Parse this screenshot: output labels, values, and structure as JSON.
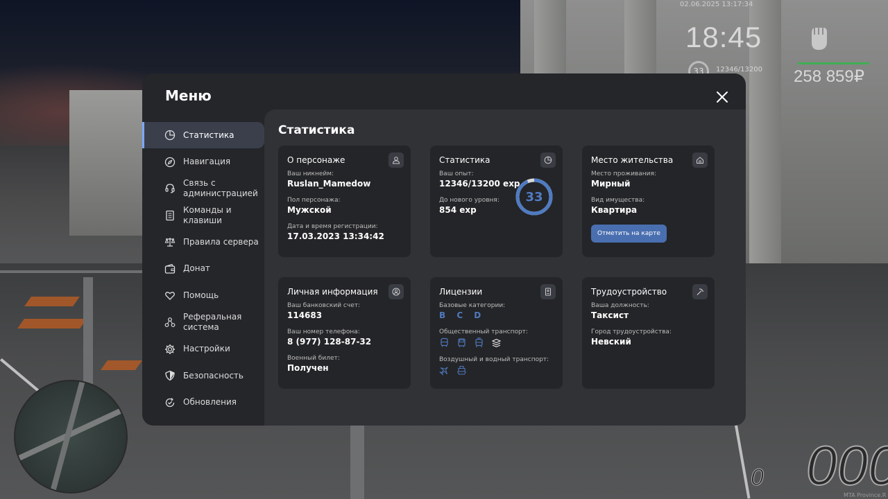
{
  "hud": {
    "datetime": "02.06.2025 13:17:34",
    "time": "18:45",
    "level": "33",
    "exp": "12346/13200",
    "money": "258 859₽",
    "speed": "000",
    "gear": "0",
    "server": "MTA Province.R"
  },
  "menu": {
    "title": "Меню",
    "nav": [
      {
        "label": "Статистика",
        "icon": "pie-chart-icon",
        "active": true
      },
      {
        "label": "Навигация",
        "icon": "compass-icon"
      },
      {
        "label": "Связь с администрацией",
        "icon": "headset-icon"
      },
      {
        "label": "Команды и клавиши",
        "icon": "document-icon"
      },
      {
        "label": "Правила сервера",
        "icon": "scales-icon"
      },
      {
        "label": "Донат",
        "icon": "wallet-icon"
      },
      {
        "label": "Помощь",
        "icon": "heart-hands-icon"
      },
      {
        "label": "Реферальная система",
        "icon": "network-icon"
      },
      {
        "label": "Настройки",
        "icon": "gear-icon"
      },
      {
        "label": "Безопасность",
        "icon": "shield-icon"
      },
      {
        "label": "Обновления",
        "icon": "refresh-check-icon"
      }
    ]
  },
  "content": {
    "title": "Статистика",
    "character": {
      "title": "О персонаже",
      "nick_label": "Ваш никнейм:",
      "nick": "Ruslan_Mamedow",
      "gender_label": "Пол персонажа:",
      "gender": "Мужской",
      "reg_label": "Дата и время регистрации:",
      "reg": "17.03.2023 13:34:42"
    },
    "stats": {
      "title": "Статистика",
      "exp_label": "Ваш опыт:",
      "exp": "12346/13200 exp",
      "next_label": "До нового уровня:",
      "next": "854 exp",
      "level": "33",
      "progress": 0.935
    },
    "residence": {
      "title": "Место жительства",
      "place_label": "Место проживания:",
      "place": "Мирный",
      "property_label": "Вид имущества:",
      "property": "Квартира",
      "map_button": "Отметить на карте"
    },
    "personal": {
      "title": "Личная информация",
      "bank_label": "Ваш банковский счет:",
      "bank": "114683",
      "phone_label": "Ваш номер телефона:",
      "phone": "8 (977) 128-87-32",
      "military_label": "Военный билет:",
      "military": "Получен"
    },
    "licenses": {
      "title": "Лицензии",
      "base_label": "Базовые категории:",
      "base": "B C D",
      "public_label": "Общественный транспорт:",
      "public_icons": [
        "bus-icon",
        "trolleybus-icon",
        "tram-icon",
        "taxi-icon"
      ],
      "air_label": "Воздушный и водный транспорт:",
      "air_icons": [
        "plane-icon",
        "boat-icon"
      ]
    },
    "employment": {
      "title": "Трудоустройство",
      "position_label": "Ваша должность:",
      "position": "Таксист",
      "city_label": "Город трудоустройства:",
      "city": "Невский"
    }
  },
  "colors": {
    "accent": "#4f7bc2",
    "panel": "#25262a",
    "content": "#313236",
    "card": "#242528",
    "active_nav": "#3a3f4b"
  }
}
